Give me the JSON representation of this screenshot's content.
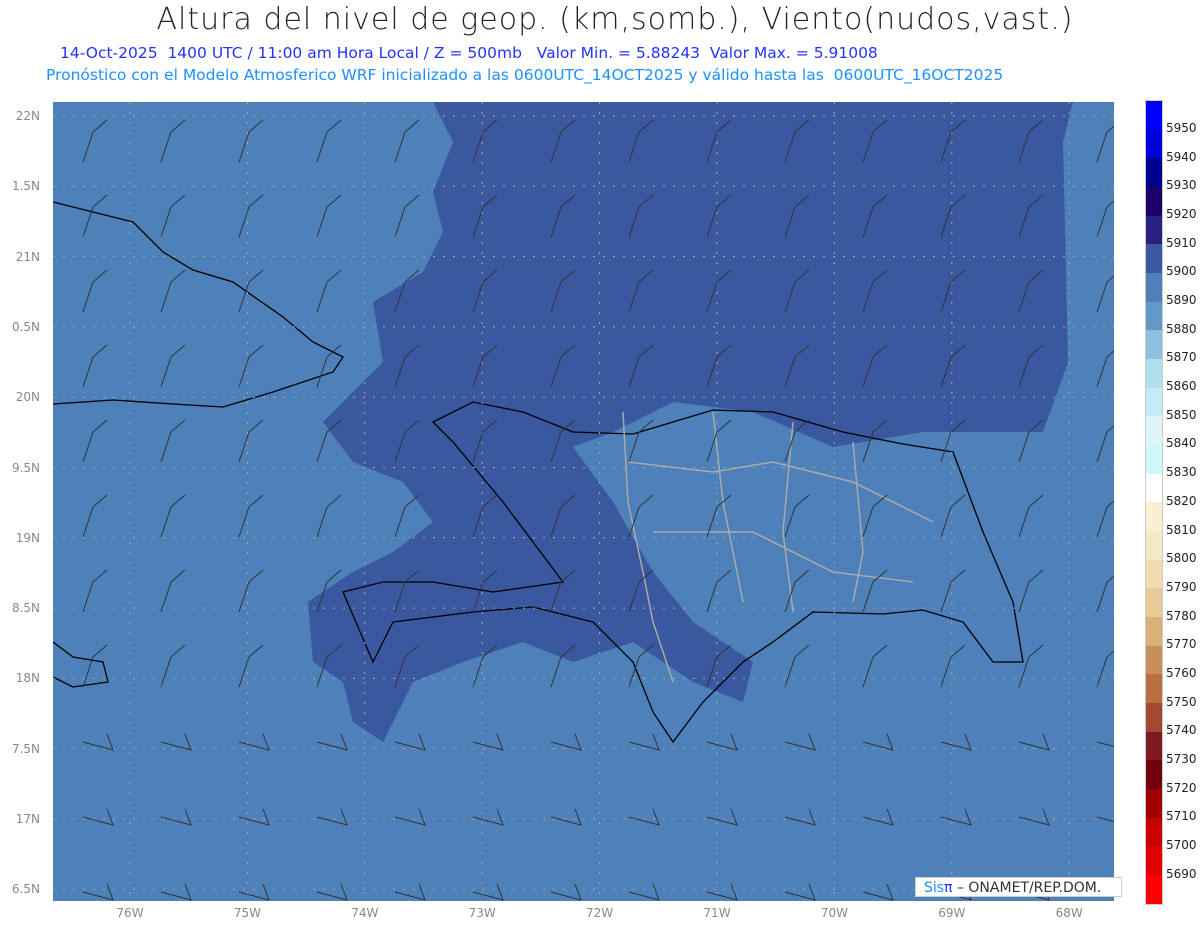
{
  "title": "Altura del nivel de geop. (km,somb.), Viento(nudos,vast.)",
  "subtitle1": "14-Oct-2025  1400 UTC / 11:00 am Hora Local / Z = 500mb   Valor Min. = 5.88243  Valor Max. = 5.91008",
  "subtitle2": "Pronóstico con el Modelo Atmosferico WRF inicializado a las 0600UTC_14OCT2025 y válido hasta las  0600UTC_16OCT2025",
  "y_axis_labels": [
    "22N",
    "1.5N",
    "21N",
    "0.5N",
    "20N",
    "9.5N",
    "19N",
    "8.5N",
    "18N",
    "7.5N",
    "17N",
    "6.5N"
  ],
  "x_axis_labels": [
    "76W",
    "75W",
    "74W",
    "73W",
    "72W",
    "71W",
    "70W",
    "69W",
    "68W"
  ],
  "colorbar": {
    "labels": [
      "5950",
      "5940",
      "5930",
      "5920",
      "5910",
      "5900",
      "5890",
      "5880",
      "5870",
      "5860",
      "5850",
      "5840",
      "5830",
      "5820",
      "5810",
      "5800",
      "5790",
      "5780",
      "5770",
      "5760",
      "5750",
      "5740",
      "5730",
      "5720",
      "5710",
      "5700",
      "5690"
    ],
    "colors": [
      "#0000ff",
      "#0000d8",
      "#000090",
      "#1c0068",
      "#2a2080",
      "#3a58a0",
      "#4e80ba",
      "#6098c8",
      "#8cc0de",
      "#b0e0ee",
      "#c4ecf4",
      "#e0f4f8",
      "#ccf8fa",
      "#ffffff",
      "#f8f0d0",
      "#f5e8c8",
      "#f0dcb0",
      "#e8cc98",
      "#d8b078",
      "#c89058",
      "#b87040",
      "#a04830",
      "#801820",
      "#700010",
      "#a00000",
      "#c80000",
      "#e00000",
      "#ff0000"
    ]
  },
  "credit": {
    "brand_a": "Sis",
    "brand_b": "π",
    "text": " –  ONAMET/REP.DOM."
  }
}
